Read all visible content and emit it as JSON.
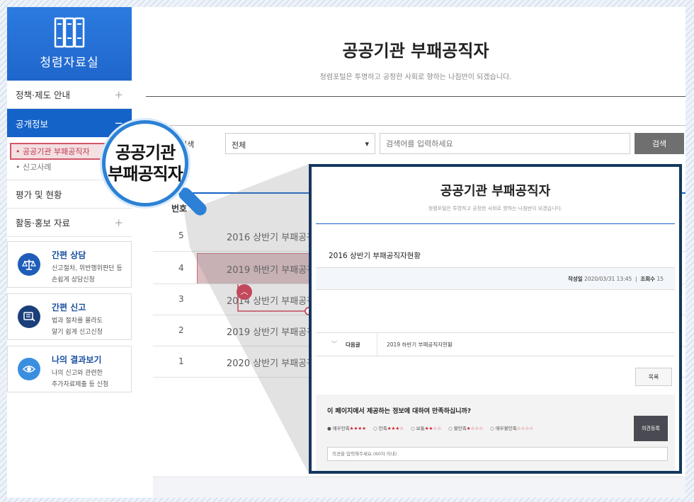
{
  "sidebar": {
    "header_title": "청렴자료실",
    "menu": [
      {
        "label": "정책·제도 안내",
        "plus": "+"
      },
      {
        "label": "공개정보",
        "plus": "−"
      }
    ],
    "submenu": [
      "공공기관 부패공직자",
      "신고사례"
    ],
    "menu2": [
      {
        "label": "평가 및 현황",
        "plus": ""
      },
      {
        "label": "활동·홍보 자료",
        "plus": "+"
      }
    ],
    "cards": [
      {
        "title": "간편 상담",
        "desc1": "신고절차, 위반행위판단 등",
        "desc2": "손쉽게 상담신청",
        "icon": "scale-icon",
        "color": "#1f5db8"
      },
      {
        "title": "간편 신고",
        "desc1": "법과 절차를 몰라도",
        "desc2": "알기 쉽게 신고신청",
        "icon": "report-icon",
        "color": "#1a3f7a"
      },
      {
        "title": "나의 결과보기",
        "desc1": "나의 신고와 관련한",
        "desc2": "추가자료제출 등 신청",
        "icon": "eye-icon",
        "color": "#3a8ee0"
      }
    ]
  },
  "main": {
    "title": "공공기관 부패공직자",
    "subtitle": "청렴포털은 투명하고 공정한 사회로 향하는 나침반이 되겠습니다.",
    "search": {
      "label": "검색",
      "select_value": "전체",
      "placeholder": "검색어를 입력하세요",
      "button": "검색"
    },
    "column_header": "번호",
    "rows": [
      {
        "num": "5",
        "title": "2016 상반기 부패공직자현황"
      },
      {
        "num": "4",
        "title": "2019 하반기 부패공직자현황"
      },
      {
        "num": "3",
        "title": "2014 상반기 부패공직자현황"
      },
      {
        "num": "2",
        "title": "2019 상반기 부패공직자현황"
      },
      {
        "num": "1",
        "title": "2020 상반기 부패공직자현황"
      }
    ]
  },
  "magnifier": {
    "line1": "공공기관",
    "line2": "부패공직자"
  },
  "panel": {
    "title": "공공기관 부패공직자",
    "subtitle": "청렴포털은 투명하고 공정한 사회로 향하는 나침반이 되겠습니다.",
    "post_title": "2016 상반기 부패공직자현황",
    "meta_date_label": "작성일",
    "meta_date": "2020/03/31 13:45",
    "meta_views_label": "조회수",
    "meta_views": "15",
    "next_label": "다음글",
    "next_title": "2019 하반기 부패공직자현황",
    "list_button": "목록",
    "survey_question": "이 페이지에서 제공하는 정보에 대하여 만족하십니까?",
    "survey_options": [
      {
        "label": "매우만족",
        "on": "★★★★",
        "off": ""
      },
      {
        "label": "만족",
        "on": "★★★",
        "off": "☆"
      },
      {
        "label": "보통",
        "on": "★★",
        "off": "☆☆"
      },
      {
        "label": "불만족",
        "on": "★",
        "off": "☆☆☆"
      },
      {
        "label": "매우불만족",
        "on": "",
        "off": "☆☆☆☆"
      }
    ],
    "submit_button": "의견등록",
    "comment_placeholder": "의견을 입력해주세요.(60자 이내)"
  },
  "colors": {
    "primary": "#1463c8",
    "panel_border": "#14375e",
    "highlight": "#c2596a"
  }
}
